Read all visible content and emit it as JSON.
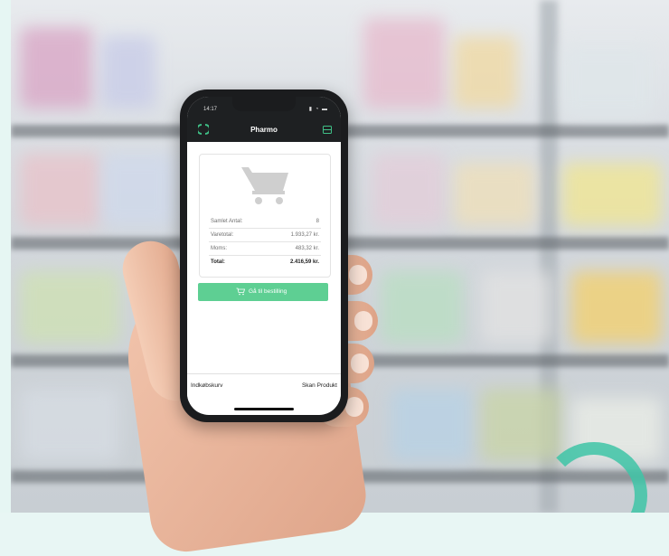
{
  "phone": {
    "status_time": "14:17",
    "status_icons": "▮ ◔ ▬",
    "app_title": "Pharmo",
    "logo_icon": "pharmo-logo-icon",
    "menu_icon": "card-icon",
    "cart_icon": "shopping-cart-icon",
    "summary": [
      {
        "label": "Samlet Antal:",
        "value": "8"
      },
      {
        "label": "Varetotal:",
        "value": "1.933,27 kr."
      },
      {
        "label": "Moms:",
        "value": "483,32 kr."
      },
      {
        "label": "Total:",
        "value": "2.416,59 kr."
      }
    ],
    "checkout_label": "Gå til bestilling",
    "tabs": {
      "left": "Indkøbskurv",
      "right": "Skan Produkt"
    }
  },
  "colors": {
    "accent_green": "#5ecf93",
    "logo_green": "#3fbf86",
    "appbar_dark": "#1e2022",
    "decor_teal": "#3fc5a7"
  }
}
